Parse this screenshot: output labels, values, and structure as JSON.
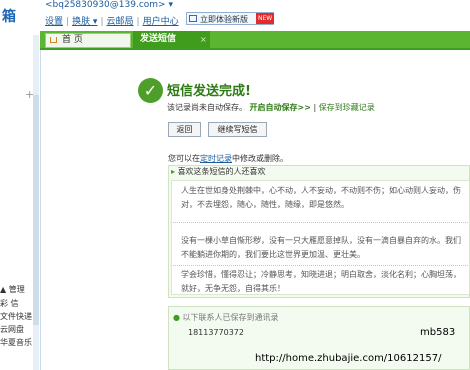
{
  "logo_text": "箱",
  "account": "<bq25830930@139.com> ▾",
  "toplinks": {
    "settings": "设置",
    "skin": "换肤 ▾",
    "cloud_mail": "云邮局",
    "user_center": "用户中心"
  },
  "new_version": {
    "label": "立即体验新版",
    "badge": "NEW"
  },
  "tabs": {
    "home": "首 页",
    "send_sms": "发送短信",
    "close": "×"
  },
  "left_nav": {
    "manage": "▲ 管理",
    "items": [
      "彩 信",
      "文件快递",
      "云网盘",
      "华夏音乐"
    ]
  },
  "left_plus": "+",
  "success": {
    "title": "短信发送完成!",
    "save_note": "该记录尚未自动保存。",
    "enable_autosave": "开启自动保存>>",
    "save_sep": "|",
    "save_to_archive": "保存到珍藏记录"
  },
  "buttons": {
    "back": "返回",
    "continue": "继续写短信"
  },
  "tip": {
    "prefix": "您可以在",
    "link": "定时记录",
    "suffix": "中修改或删除。"
  },
  "quote": {
    "header_arrow": "▸",
    "header": "喜欢这条短信的人还喜欢",
    "paragraphs": [
      [
        "人生在世如身处荆棘中，心不动，人不妄动，不动则不伤；如心动则人妄动，伤",
        "对，不去埋怨，随心，随性，随缘，即是悠然。"
      ],
      [
        "没有一棵小草自惭形秽，没有一只大雁愿意掉队，没有一滴自暴自弃的水。我们",
        "不能躺进你期的，我们要比这世界更加温、更壮美。"
      ],
      [
        "学会珍惜，懂得忍让；冷静思考，知晓进退；明白取舍，淡化名利；心胸坦荡，",
        "就好，无争无怨，自得其乐！"
      ]
    ]
  },
  "contacts": {
    "dot": "●",
    "header": "以下联系人已保存到通讯录",
    "phone": "18113770372"
  },
  "watermark": {
    "user": "mb583",
    "url": "http://home.zhubajie.com/10612157/"
  }
}
